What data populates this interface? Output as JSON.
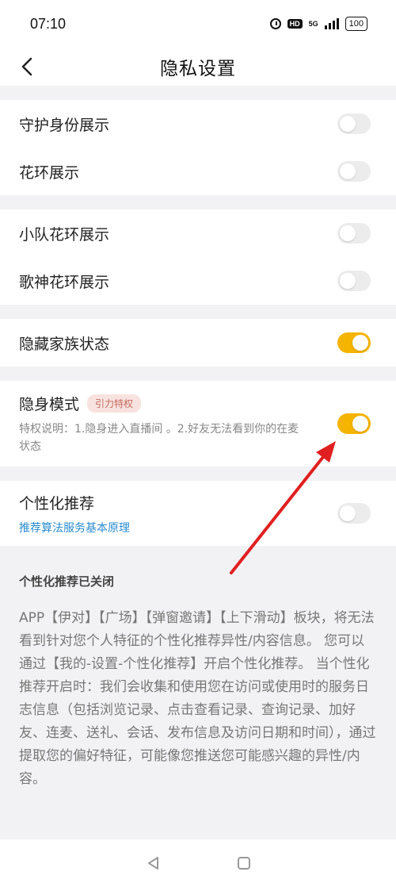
{
  "status_bar": {
    "time": "07:10",
    "hd": "HD",
    "network": "5G",
    "battery": "100"
  },
  "header": {
    "title": "隐私设置"
  },
  "groups": {
    "identity": {
      "label": "守护身份展示",
      "enabled": false
    },
    "wreath": {
      "label": "花环展示",
      "enabled": false
    },
    "team_wreath": {
      "label": "小队花环展示",
      "enabled": false
    },
    "singer_wreath": {
      "label": "歌神花环展示",
      "enabled": false
    },
    "hide_family": {
      "label": "隐藏家族状态",
      "enabled": true
    },
    "stealth": {
      "label": "隐身模式",
      "badge": "引力特权",
      "description": "特权说明：1.隐身进入直播间 。2.好友无法看到你的在麦状态",
      "enabled": true
    },
    "recommend": {
      "label": "个性化推荐",
      "link": "推荐算法服务基本原理",
      "enabled": false
    }
  },
  "info": {
    "title": "个性化推荐已关闭",
    "body": "APP【伊对】【广场】【弹窗邀请】【上下滑动】板块，将无法看到针对您个人特征的个性化推荐异性/内容信息。 您可以通过【我的-设置-个性化推荐】开启个性化推荐。 当个性化推荐开启时：我们会收集和使用您在访问或使用时的服务日志信息（包括浏览记录、点击查看记录、查询记录、加好友、连麦、送礼、会话、发布信息及访问日期和时间），通过提取您的偏好特征，可能像您推送您可能感兴趣的异性/内容。"
  },
  "colors": {
    "accent": "#f5b400",
    "link": "#2a8ccf",
    "badge_bg": "#f8e2df",
    "badge_text": "#c46a5e",
    "annotation": "#e02020"
  },
  "icons": {
    "back": "chevron-left-icon",
    "nav_back": "triangle-back-icon",
    "nav_home": "square-home-icon"
  }
}
